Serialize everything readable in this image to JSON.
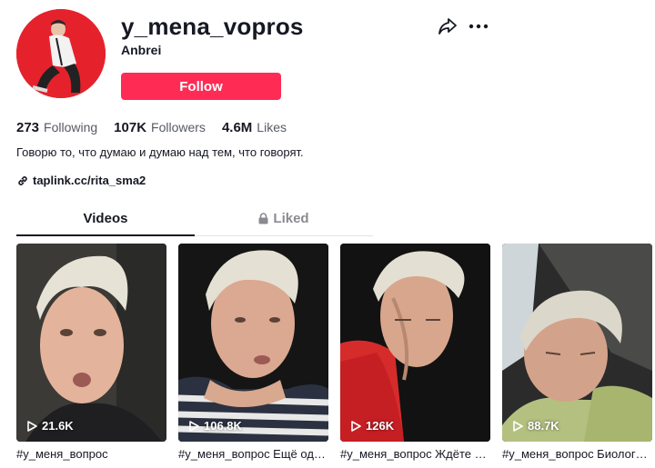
{
  "profile": {
    "username": "y_mena_vopros",
    "nickname": "Anbrei",
    "follow_label": "Follow",
    "share_icon": "share-icon",
    "more_icon": "more-icon"
  },
  "stats": {
    "following_count": "273",
    "following_label": "Following",
    "followers_count": "107K",
    "followers_label": "Followers",
    "likes_count": "4.6M",
    "likes_label": "Likes"
  },
  "bio": "Говорю то, что думаю и думаю над тем, что говорят.",
  "link": {
    "icon": "link-icon",
    "text": "taplink.cc/rita_sma2"
  },
  "tabs": {
    "videos_label": "Videos",
    "liked_label": "Liked",
    "liked_icon": "lock-icon",
    "active": "videos"
  },
  "videos": [
    {
      "views": "21.6K",
      "caption": "#у_меня_вопрос"
    },
    {
      "views": "106.8K",
      "caption": "#у_меня_вопрос Ещё одна подборка"
    },
    {
      "views": "126K",
      "caption": "#у_меня_вопрос Ждёте продолжения"
    },
    {
      "views": "88.7K",
      "caption": "#у_меня_вопрос Биология и жизнь"
    }
  ],
  "colors": {
    "brand": "#fe2c55",
    "avatar_bg": "#e5222c",
    "text": "#161823",
    "muted": "#565a63"
  }
}
